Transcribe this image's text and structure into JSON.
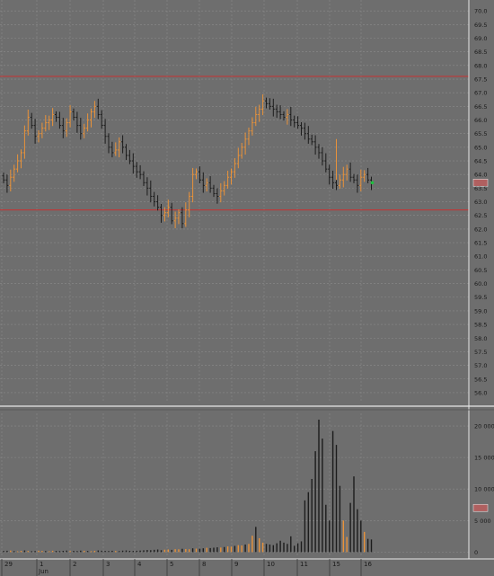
{
  "colors": {
    "background": "#6e6e6e",
    "grid": "#8a8a8a",
    "up": "#e8923a",
    "down": "#1c1c1c",
    "hline": "#c83232",
    "price_marker": "#b06060",
    "last_dot": "#1fbf3f",
    "separator": "#e8e8e8"
  },
  "chart_data": [
    {
      "type": "ohlc",
      "price_axis": {
        "range": [
          55.8,
          70.5
        ],
        "ticks": [
          "70.5",
          "70.0",
          "69.5",
          "69.0",
          "68.5",
          "68.0",
          "67.5",
          "67.0",
          "66.5",
          "66.0",
          "65.5",
          "65.0",
          "64.5",
          "64.0",
          "63.5",
          "63.0",
          "62.5",
          "62.0",
          "61.5",
          "61.0",
          "60.5",
          "60.0",
          "59.5",
          "59.0",
          "58.5",
          "58.0",
          "57.5",
          "57.0",
          "56.5",
          "56.0"
        ]
      },
      "horizontal_lines": [
        67.6,
        62.7
      ],
      "closes": [
        63.8,
        63.6,
        63.9,
        64.2,
        64.5,
        64.8,
        65.6,
        66.1,
        65.8,
        65.4,
        65.5,
        65.7,
        65.9,
        66.0,
        66.2,
        66.1,
        65.8,
        65.6,
        65.9,
        66.3,
        66.1,
        65.8,
        65.5,
        65.7,
        66.0,
        66.3,
        66.5,
        66.2,
        65.8,
        65.4,
        65.0,
        64.8,
        64.9,
        65.2,
        65.0,
        64.7,
        64.5,
        64.3,
        64.1,
        64.0,
        63.7,
        63.5,
        63.2,
        63.0,
        62.8,
        62.5,
        62.6,
        62.8,
        62.3,
        62.4,
        62.6,
        62.2,
        62.7,
        63.2,
        64.0,
        64.1,
        63.8,
        63.6,
        63.7,
        63.5,
        63.3,
        63.2,
        63.4,
        63.6,
        63.9,
        64.1,
        64.4,
        64.7,
        65.0,
        65.3,
        65.6,
        65.9,
        66.2,
        66.4,
        66.7,
        66.6,
        66.5,
        66.4,
        66.3,
        66.2,
        66.1,
        66.2,
        66.0,
        65.9,
        65.8,
        65.7,
        65.5,
        65.3,
        65.2,
        65.0,
        64.8,
        64.5,
        64.2,
        63.9,
        63.7,
        63.6,
        63.8,
        64.0,
        64.2,
        63.9,
        63.8,
        63.6,
        63.9,
        64.0,
        63.8,
        63.7
      ],
      "last_price": 63.7,
      "y_unit": "price"
    },
    {
      "type": "bar",
      "volume_axis": {
        "range": [
          -800,
          22000
        ],
        "ticks": [
          "20 000",
          "15 000",
          "10 000",
          "5 000",
          "0"
        ]
      },
      "volumes": [
        180,
        210,
        240,
        150,
        120,
        200,
        260,
        180,
        140,
        170,
        220,
        190,
        160,
        130,
        210,
        180,
        150,
        200,
        240,
        170,
        190,
        160,
        230,
        210,
        180,
        140,
        200,
        260,
        220,
        190,
        170,
        210,
        180,
        150,
        230,
        260,
        200,
        180,
        210,
        240,
        280,
        330,
        300,
        360,
        410,
        300,
        380,
        420,
        350,
        460,
        440,
        520,
        480,
        450,
        600,
        550,
        520,
        600,
        680,
        640,
        700,
        760,
        720,
        800,
        900,
        860,
        980,
        1100,
        1050,
        1200,
        1300,
        2600,
        4000,
        2200,
        1500,
        1300,
        1200,
        1100,
        1400,
        1800,
        1500,
        1300,
        2500,
        1000,
        1400,
        1700,
        8200,
        9500,
        11600,
        16000,
        21000,
        18000,
        7500,
        5000,
        19200,
        17000,
        10500,
        5000,
        2400,
        7800,
        12000,
        6800,
        5000,
        3200,
        2100,
        2000
      ],
      "y_unit": "volume"
    }
  ],
  "x_axis": {
    "labels": [
      "29",
      "1",
      "2",
      "3",
      "4",
      "5",
      "8",
      "9",
      "10",
      "11",
      "15",
      "16"
    ],
    "sub_labels": [
      "Jun"
    ]
  }
}
